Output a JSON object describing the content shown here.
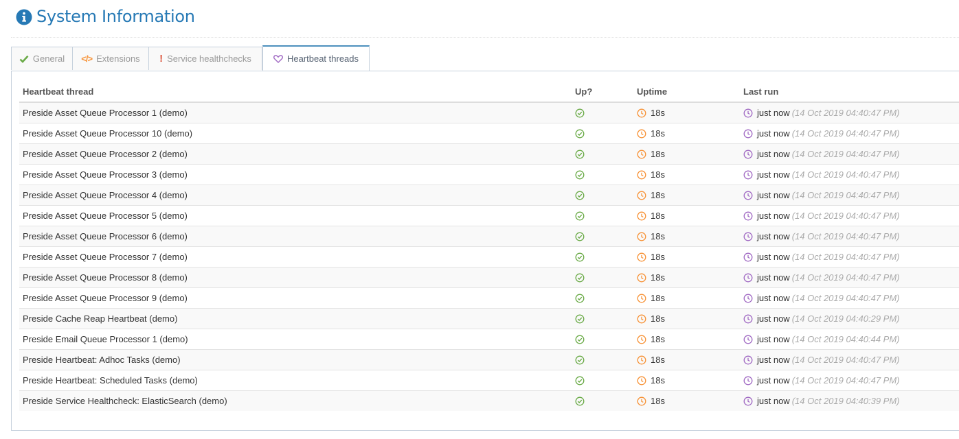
{
  "header": {
    "title": "System Information"
  },
  "tabs": [
    {
      "label": "General",
      "icon": "check-icon",
      "color": "#69aa46",
      "active": false
    },
    {
      "label": "Extensions",
      "icon": "code-icon",
      "color": "#f79236",
      "active": false
    },
    {
      "label": "Service healthchecks",
      "icon": "exclamation-icon",
      "color": "#dd5a43",
      "active": false
    },
    {
      "label": "Heartbeat threads",
      "icon": "heart-icon",
      "color": "#a069c3",
      "active": true
    }
  ],
  "table": {
    "columns": [
      "Heartbeat thread",
      "Up?",
      "Uptime",
      "Last run"
    ],
    "rows": [
      {
        "name": "Preside Asset Queue Processor 1 (demo)",
        "uptime": "18s",
        "last_run": "just now",
        "timestamp": "(14 Oct 2019 04:40:47 PM)"
      },
      {
        "name": "Preside Asset Queue Processor 10 (demo)",
        "uptime": "18s",
        "last_run": "just now",
        "timestamp": "(14 Oct 2019 04:40:47 PM)"
      },
      {
        "name": "Preside Asset Queue Processor 2 (demo)",
        "uptime": "18s",
        "last_run": "just now",
        "timestamp": "(14 Oct 2019 04:40:47 PM)"
      },
      {
        "name": "Preside Asset Queue Processor 3 (demo)",
        "uptime": "18s",
        "last_run": "just now",
        "timestamp": "(14 Oct 2019 04:40:47 PM)"
      },
      {
        "name": "Preside Asset Queue Processor 4 (demo)",
        "uptime": "18s",
        "last_run": "just now",
        "timestamp": "(14 Oct 2019 04:40:47 PM)"
      },
      {
        "name": "Preside Asset Queue Processor 5 (demo)",
        "uptime": "18s",
        "last_run": "just now",
        "timestamp": "(14 Oct 2019 04:40:47 PM)"
      },
      {
        "name": "Preside Asset Queue Processor 6 (demo)",
        "uptime": "18s",
        "last_run": "just now",
        "timestamp": "(14 Oct 2019 04:40:47 PM)"
      },
      {
        "name": "Preside Asset Queue Processor 7 (demo)",
        "uptime": "18s",
        "last_run": "just now",
        "timestamp": "(14 Oct 2019 04:40:47 PM)"
      },
      {
        "name": "Preside Asset Queue Processor 8 (demo)",
        "uptime": "18s",
        "last_run": "just now",
        "timestamp": "(14 Oct 2019 04:40:47 PM)"
      },
      {
        "name": "Preside Asset Queue Processor 9 (demo)",
        "uptime": "18s",
        "last_run": "just now",
        "timestamp": "(14 Oct 2019 04:40:47 PM)"
      },
      {
        "name": "Preside Cache Reap Heartbeat (demo)",
        "uptime": "18s",
        "last_run": "just now",
        "timestamp": "(14 Oct 2019 04:40:29 PM)"
      },
      {
        "name": "Preside Email Queue Processor 1 (demo)",
        "uptime": "18s",
        "last_run": "just now",
        "timestamp": "(14 Oct 2019 04:40:44 PM)"
      },
      {
        "name": "Preside Heartbeat: Adhoc Tasks (demo)",
        "uptime": "18s",
        "last_run": "just now",
        "timestamp": "(14 Oct 2019 04:40:47 PM)"
      },
      {
        "name": "Preside Heartbeat: Scheduled Tasks (demo)",
        "uptime": "18s",
        "last_run": "just now",
        "timestamp": "(14 Oct 2019 04:40:47 PM)"
      },
      {
        "name": "Preside Service Healthcheck: ElasticSearch (demo)",
        "uptime": "18s",
        "last_run": "just now",
        "timestamp": "(14 Oct 2019 04:40:39 PM)"
      }
    ]
  },
  "icons": {
    "up": "check-circle-icon",
    "uptime": "clock-icon",
    "last_run": "clock-icon"
  },
  "colors": {
    "title": "#2679b5",
    "up": "#69aa46",
    "uptime": "#f79236",
    "last_run": "#a069c3"
  }
}
